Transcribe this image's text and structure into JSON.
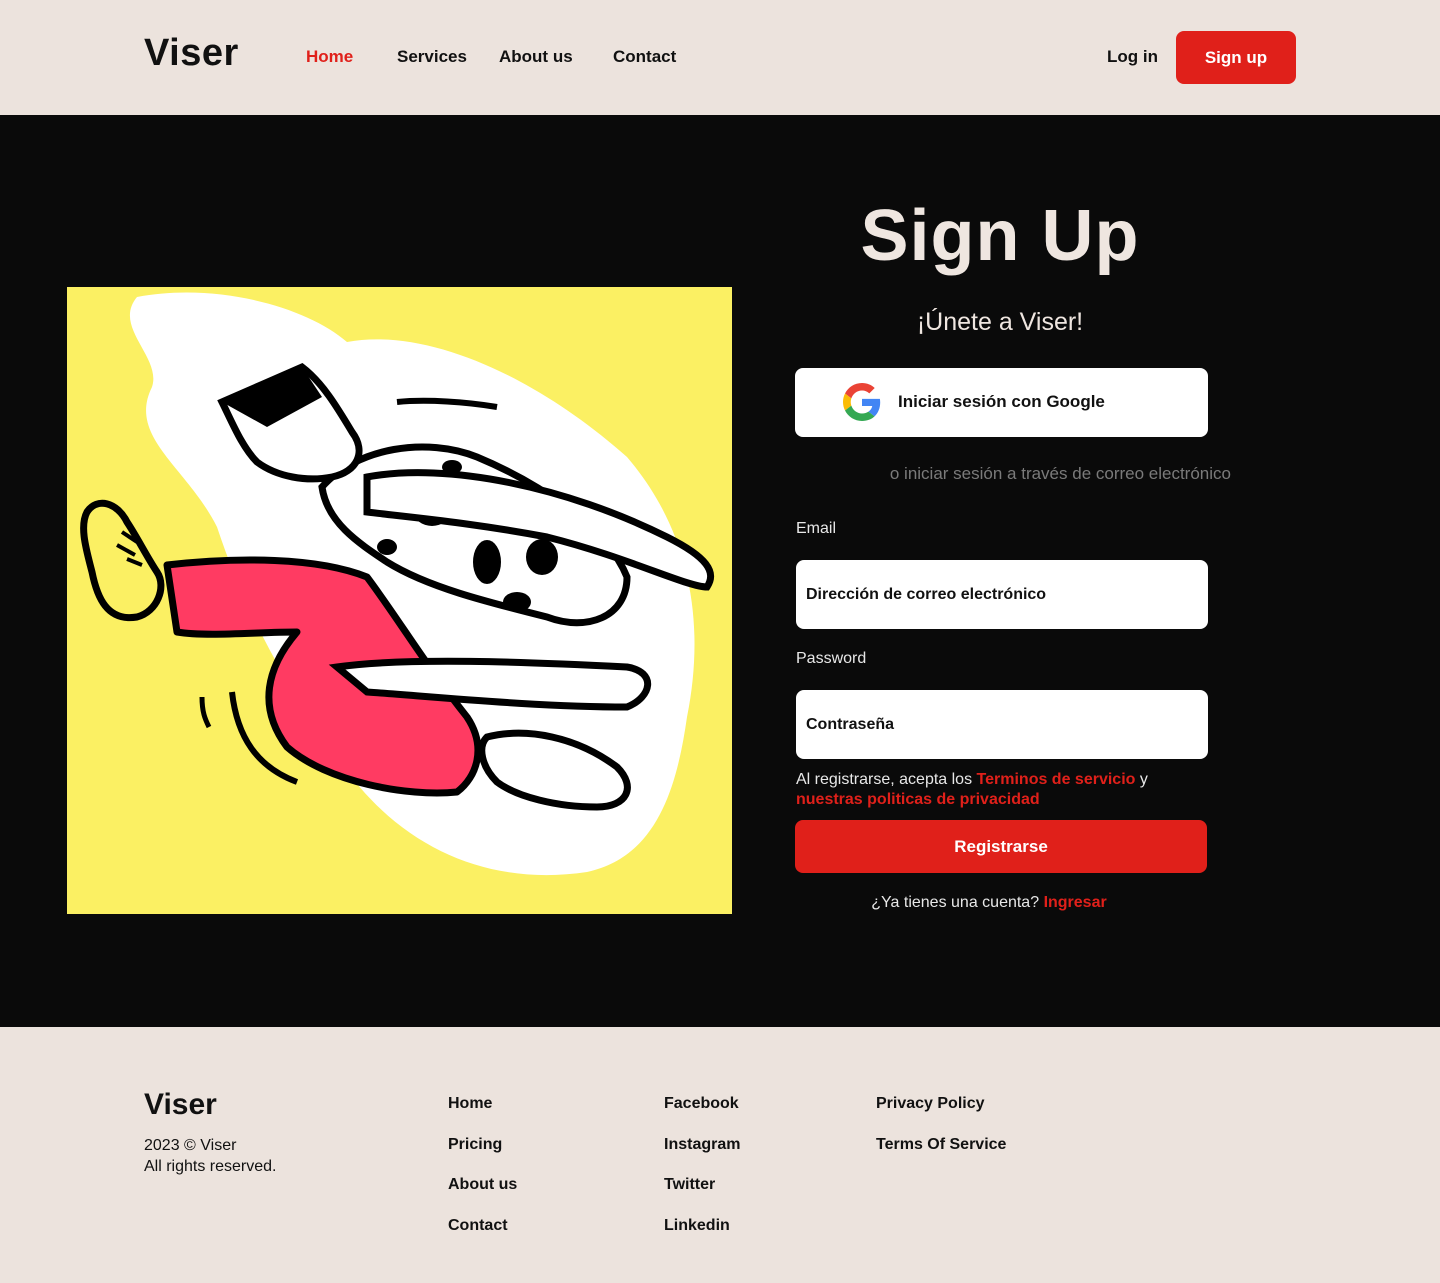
{
  "header": {
    "logo": "Viser",
    "nav": [
      {
        "label": "Home",
        "active": true
      },
      {
        "label": "Services",
        "active": false
      },
      {
        "label": "About us",
        "active": false
      },
      {
        "label": "Contact",
        "active": false
      }
    ],
    "login_label": "Log in",
    "signup_label": "Sign up"
  },
  "form": {
    "title": "Sign Up",
    "subtitle": "¡Únete a Viser!",
    "google_label": "Iniciar sesión con Google",
    "divider_text": "o iniciar sesión a través de correo electrónico",
    "email_label": "Email",
    "email_placeholder": "Dirección de correo electrónico",
    "password_label": "Password",
    "password_placeholder": "Contraseña",
    "terms_prefix": "Al registrarse, acepta los",
    "terms_link": "Terminos de servicio",
    "terms_joiner": "y",
    "privacy_link": "nuestras politicas de privacidad",
    "register_label": "Registrarse",
    "have_account_text": "¿Ya tienes una cuenta?",
    "login_link": "Ingresar"
  },
  "footer": {
    "logo": "Viser",
    "copyright_line1": "2023 © Viser",
    "copyright_line2": "All rights reserved.",
    "col1": [
      "Home",
      "Pricing",
      "About us",
      "Contact"
    ],
    "col2": [
      "Facebook",
      "Instagram",
      "Twitter",
      "Linkedin"
    ],
    "col3": [
      "Privacy Policy",
      "Terms Of Service"
    ]
  },
  "colors": {
    "accent": "#e0201a",
    "background": "#ece3dd",
    "dark": "#0a0a0a",
    "illustration_bg": "#fbf063",
    "pants": "#ff3b62"
  },
  "icons": [
    "google-icon"
  ]
}
